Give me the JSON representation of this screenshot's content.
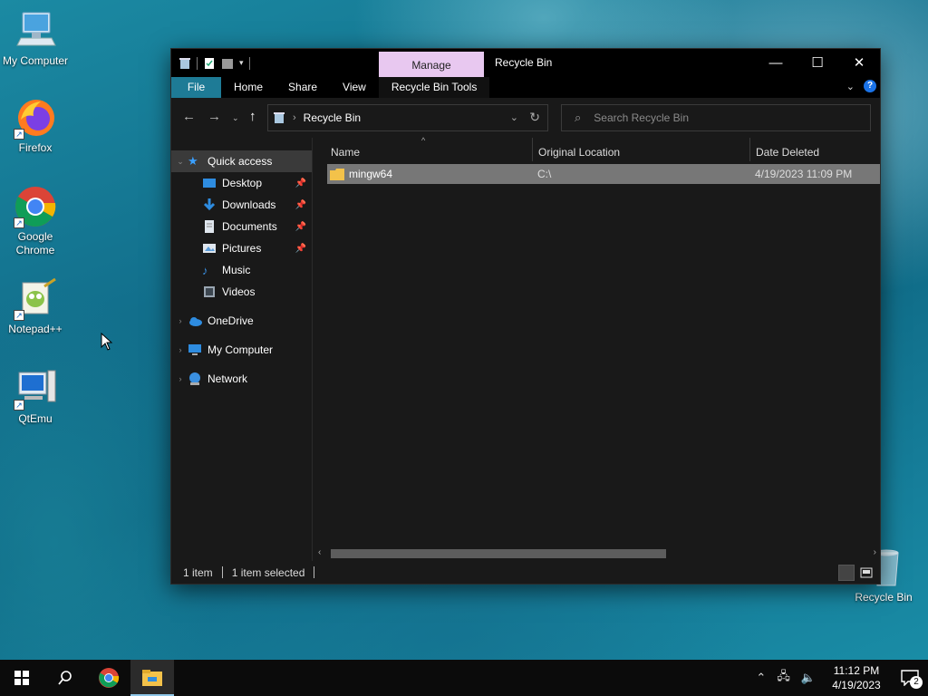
{
  "desktop": {
    "icons": [
      {
        "label": "My Computer",
        "icon": "computer-icon"
      },
      {
        "label": "Firefox",
        "icon": "firefox-icon"
      },
      {
        "label": "Google Chrome",
        "icon": "chrome-icon"
      },
      {
        "label": "Notepad++",
        "icon": "notepadpp-icon"
      },
      {
        "label": "QtEmu",
        "icon": "qtemu-icon"
      },
      {
        "label": "Recycle Bin",
        "icon": "recycle-bin-icon"
      }
    ]
  },
  "explorer": {
    "title": "Recycle Bin",
    "manage_tab": "Manage",
    "tabs": {
      "file": "File",
      "home": "Home",
      "share": "Share",
      "view": "View",
      "tools": "Recycle Bin Tools"
    },
    "address": "Recycle Bin",
    "search_placeholder": "Search Recycle Bin",
    "nav": {
      "quick_access": "Quick access",
      "desktop": "Desktop",
      "downloads": "Downloads",
      "documents": "Documents",
      "pictures": "Pictures",
      "music": "Music",
      "videos": "Videos",
      "onedrive": "OneDrive",
      "my_computer": "My Computer",
      "network": "Network"
    },
    "columns": {
      "name": "Name",
      "original_location": "Original Location",
      "date_deleted": "Date Deleted"
    },
    "items": [
      {
        "name": "mingw64",
        "original_location": "C:\\",
        "date_deleted": "4/19/2023 11:09 PM",
        "selected": true
      }
    ],
    "status": {
      "count": "1 item",
      "selection": "1 item selected"
    }
  },
  "taskbar": {
    "time": "11:12 PM",
    "date": "4/19/2023",
    "notification_count": "2"
  },
  "colors": {
    "accent": "#1e7b96",
    "manage_tab": "#e8c8f0",
    "window_bg": "#191919",
    "selection": "#777777"
  }
}
